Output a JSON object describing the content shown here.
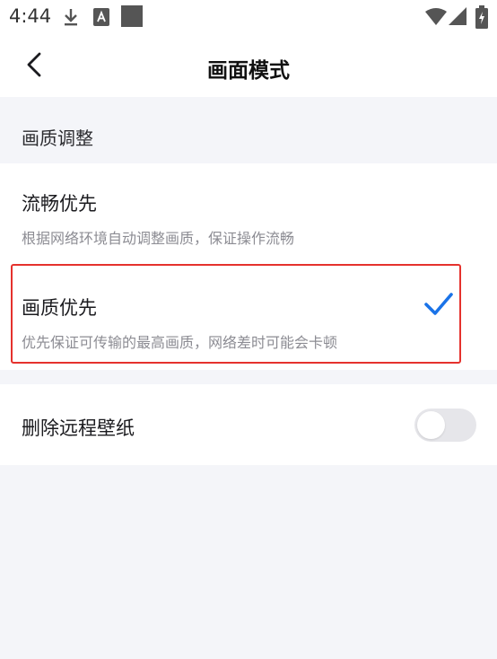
{
  "status_bar": {
    "time": "4:44",
    "icons": [
      "download-icon",
      "a-badge-icon",
      "square-notification-icon",
      "wifi-icon",
      "signal-icon",
      "battery-charging-icon"
    ]
  },
  "header": {
    "title": "画面模式",
    "back_icon": "chevron-left-icon"
  },
  "section": {
    "label": "画质调整"
  },
  "options": [
    {
      "title": "流畅优先",
      "description": "根据网络环境自动调整画质，保证操作流畅",
      "selected": false
    },
    {
      "title": "画质优先",
      "description": "优先保证可传输的最高画质，网络差时可能会卡顿",
      "selected": true
    }
  ],
  "wallpaper_setting": {
    "label": "删除远程壁纸",
    "enabled": false
  },
  "colors": {
    "accent": "#1a73e8",
    "highlight": "#e5322d",
    "background": "#f4f5f9",
    "toggle_off": "#e6e6ea"
  }
}
